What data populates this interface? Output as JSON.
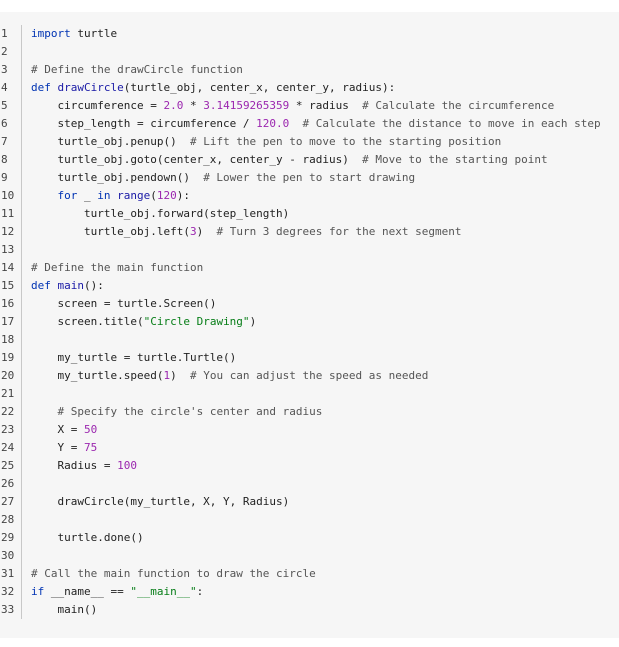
{
  "editor": {
    "language": "python",
    "theme": {
      "background": "#f6f6f6",
      "keyword": "#0033b3",
      "function": "#1a1aa6",
      "number": "#9b27af",
      "string": "#067d17",
      "comment": "#555555",
      "text": "#1f1f1f"
    },
    "lines": [
      {
        "n": "1",
        "t": [
          {
            "c": "kw",
            "s": "import"
          },
          {
            "c": "",
            "s": " turtle"
          }
        ]
      },
      {
        "n": "2",
        "t": []
      },
      {
        "n": "3",
        "t": [
          {
            "c": "cm",
            "s": "# Define the drawCircle function"
          }
        ]
      },
      {
        "n": "4",
        "t": [
          {
            "c": "kw",
            "s": "def"
          },
          {
            "c": "",
            "s": " "
          },
          {
            "c": "fn",
            "s": "drawCircle"
          },
          {
            "c": "",
            "s": "(turtle_obj, center_x, center_y, radius):"
          }
        ]
      },
      {
        "n": "5",
        "t": [
          {
            "c": "",
            "s": "    circumference = "
          },
          {
            "c": "num",
            "s": "2.0"
          },
          {
            "c": "",
            "s": " * "
          },
          {
            "c": "num",
            "s": "3.14159265359"
          },
          {
            "c": "",
            "s": " * radius  "
          },
          {
            "c": "cm",
            "s": "# Calculate the circumference"
          }
        ]
      },
      {
        "n": "6",
        "t": [
          {
            "c": "",
            "s": "    step_length = circumference / "
          },
          {
            "c": "num",
            "s": "120.0"
          },
          {
            "c": "",
            "s": "  "
          },
          {
            "c": "cm",
            "s": "# Calculate the distance to move in each step"
          }
        ]
      },
      {
        "n": "7",
        "t": [
          {
            "c": "",
            "s": "    turtle_obj.penup()  "
          },
          {
            "c": "cm",
            "s": "# Lift the pen to move to the starting position"
          }
        ]
      },
      {
        "n": "8",
        "t": [
          {
            "c": "",
            "s": "    turtle_obj.goto(center_x, center_y - radius)  "
          },
          {
            "c": "cm",
            "s": "# Move to the starting point"
          }
        ]
      },
      {
        "n": "9",
        "t": [
          {
            "c": "",
            "s": "    turtle_obj.pendown()  "
          },
          {
            "c": "cm",
            "s": "# Lower the pen to start drawing"
          }
        ]
      },
      {
        "n": "10",
        "t": [
          {
            "c": "",
            "s": "    "
          },
          {
            "c": "kw",
            "s": "for"
          },
          {
            "c": "",
            "s": " _ "
          },
          {
            "c": "kw",
            "s": "in"
          },
          {
            "c": "",
            "s": " "
          },
          {
            "c": "fn",
            "s": "range"
          },
          {
            "c": "",
            "s": "("
          },
          {
            "c": "num",
            "s": "120"
          },
          {
            "c": "",
            "s": "):"
          }
        ]
      },
      {
        "n": "11",
        "t": [
          {
            "c": "",
            "s": "        turtle_obj.forward(step_length)"
          }
        ]
      },
      {
        "n": "12",
        "t": [
          {
            "c": "",
            "s": "        turtle_obj.left("
          },
          {
            "c": "num",
            "s": "3"
          },
          {
            "c": "",
            "s": ")  "
          },
          {
            "c": "cm",
            "s": "# Turn 3 degrees for the next segment"
          }
        ]
      },
      {
        "n": "13",
        "t": []
      },
      {
        "n": "14",
        "t": [
          {
            "c": "cm",
            "s": "# Define the main function"
          }
        ]
      },
      {
        "n": "15",
        "t": [
          {
            "c": "kw",
            "s": "def"
          },
          {
            "c": "",
            "s": " "
          },
          {
            "c": "fn",
            "s": "main"
          },
          {
            "c": "",
            "s": "():"
          }
        ]
      },
      {
        "n": "16",
        "t": [
          {
            "c": "",
            "s": "    screen = turtle.Screen()"
          }
        ]
      },
      {
        "n": "17",
        "t": [
          {
            "c": "",
            "s": "    screen.title("
          },
          {
            "c": "str",
            "s": "\"Circle Drawing\""
          },
          {
            "c": "",
            "s": ")"
          }
        ]
      },
      {
        "n": "18",
        "t": []
      },
      {
        "n": "19",
        "t": [
          {
            "c": "",
            "s": "    my_turtle = turtle.Turtle()"
          }
        ]
      },
      {
        "n": "20",
        "t": [
          {
            "c": "",
            "s": "    my_turtle.speed("
          },
          {
            "c": "num",
            "s": "1"
          },
          {
            "c": "",
            "s": ")  "
          },
          {
            "c": "cm",
            "s": "# You can adjust the speed as needed"
          }
        ]
      },
      {
        "n": "21",
        "t": []
      },
      {
        "n": "22",
        "t": [
          {
            "c": "",
            "s": "    "
          },
          {
            "c": "cm",
            "s": "# Specify the circle's center and radius"
          }
        ]
      },
      {
        "n": "23",
        "t": [
          {
            "c": "",
            "s": "    X = "
          },
          {
            "c": "num",
            "s": "50"
          }
        ]
      },
      {
        "n": "24",
        "t": [
          {
            "c": "",
            "s": "    Y = "
          },
          {
            "c": "num",
            "s": "75"
          }
        ]
      },
      {
        "n": "25",
        "t": [
          {
            "c": "",
            "s": "    Radius = "
          },
          {
            "c": "num",
            "s": "100"
          }
        ]
      },
      {
        "n": "26",
        "t": []
      },
      {
        "n": "27",
        "t": [
          {
            "c": "",
            "s": "    drawCircle(my_turtle, X, Y, Radius)"
          }
        ]
      },
      {
        "n": "28",
        "t": []
      },
      {
        "n": "29",
        "t": [
          {
            "c": "",
            "s": "    turtle.done()"
          }
        ]
      },
      {
        "n": "30",
        "t": []
      },
      {
        "n": "31",
        "t": [
          {
            "c": "cm",
            "s": "# Call the main function to draw the circle"
          }
        ]
      },
      {
        "n": "32",
        "t": [
          {
            "c": "kw",
            "s": "if"
          },
          {
            "c": "",
            "s": " __name__ == "
          },
          {
            "c": "str",
            "s": "\"__main__\""
          },
          {
            "c": "",
            "s": ":"
          }
        ]
      },
      {
        "n": "33",
        "t": [
          {
            "c": "",
            "s": "    main()"
          }
        ]
      }
    ]
  }
}
